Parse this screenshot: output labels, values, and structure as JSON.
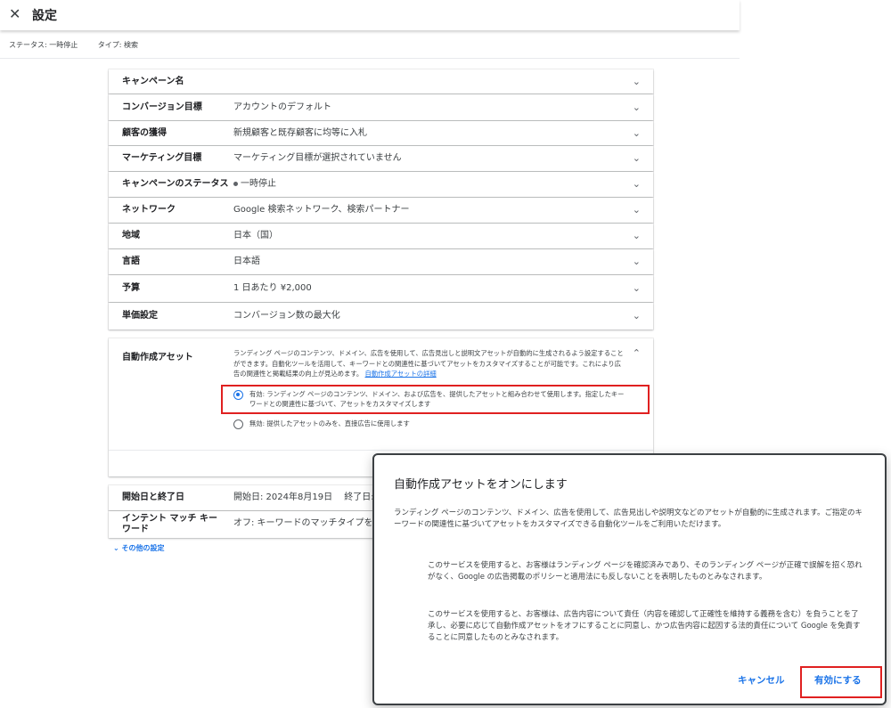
{
  "header": {
    "close_icon": "✕",
    "title": "設定"
  },
  "status": {
    "status_text": "ステータス: 一時停止",
    "type_text": "タイプ: 検索"
  },
  "settings": [
    {
      "label": "キャンペーン名",
      "value": ""
    },
    {
      "label": "コンバージョン目標",
      "value": "アカウントのデフォルト"
    },
    {
      "label": "顧客の獲得",
      "value": "新規顧客と既存顧客に均等に入札"
    },
    {
      "label": "マーケティング目標",
      "value": "マーケティング目標が選択されていません"
    },
    {
      "label": "キャンペーンのステータス",
      "value": "一時停止"
    },
    {
      "label": "ネットワーク",
      "value": "Google 検索ネットワーク、検索パートナー"
    },
    {
      "label": "地域",
      "value": "日本（国）"
    },
    {
      "label": "言語",
      "value": "日本語"
    },
    {
      "label": "予算",
      "value": "1 日あたり ¥2,000"
    },
    {
      "label": "単価設定",
      "value": "コンバージョン数の最大化"
    }
  ],
  "auto_assets": {
    "label": "自動作成アセット",
    "description": "ランディング ページのコンテンツ、ドメイン、広告を使用して、広告見出しと説明文アセットが自動的に生成されるよう設定することができます。自動化ツールを活用して、キーワードとの関連性に基づいてアセットをカスタマイズすることが可能です。これにより広告の関連性と掲載結果の向上が見込めます。",
    "link": "自動作成アセットの詳細",
    "option_on": "有効: ランディング ページのコンテンツ、ドメイン、および広告を、提供したアセットと組み合わせて使用します。指定したキーワードとの関連性に基づいて、アセットをカスタマイズします",
    "option_off": "無効: 提供したアセットのみを、直接広告に使用します"
  },
  "lower_rows": [
    {
      "label": "開始日と終了日",
      "value": "開始日: 2024年8月19日　 終了日:"
    },
    {
      "label": "インテント マッチ キーワード",
      "value": "オフ: キーワードのマッチタイプを使"
    }
  ],
  "more_settings": "その他の設定",
  "dialog": {
    "title": "自動作成アセットをオンにします",
    "p1": "ランディング ページのコンテンツ、ドメイン、広告を使用して、広告見出しや説明文などのアセットが自動的に生成されます。ご指定のキーワードの関連性に基づいてアセットをカスタマイズできる自動化ツールをご利用いただけます。",
    "p2": "このサービスを使用すると、お客様はランディング ページを確認済みであり、そのランディング ページが正確で誤解を招く恐れがなく、Google の広告掲載のポリシーと適用法にも反しないことを表明したものとみなされます。",
    "p3": "このサービスを使用すると、お客様は、広告内容について責任（内容を確認して正確性を維持する義務を含む）を負うことを了承し、必要に応じて自動作成アセットをオフにすることに同意し、かつ広告内容に起因する法的責任について Google を免責することに同意したものとみなされます。",
    "cancel": "キャンセル",
    "confirm": "有効にする"
  },
  "colors": {
    "accent": "#1a73e8",
    "highlight": "#e02020"
  }
}
